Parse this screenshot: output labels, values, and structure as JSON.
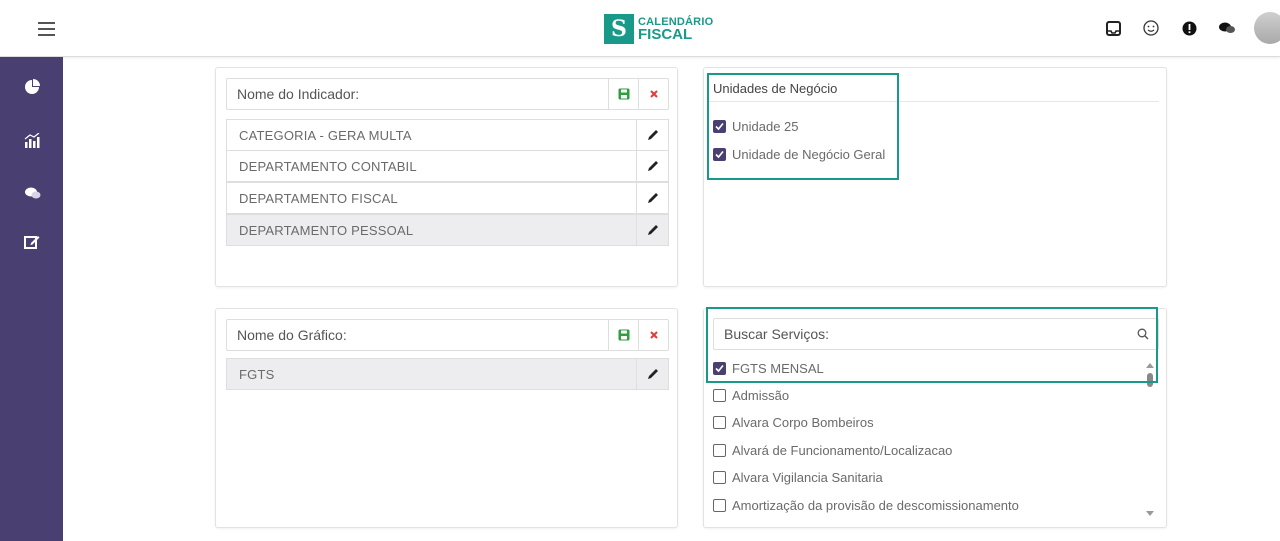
{
  "header": {
    "logo_line1": "CALENDÁRIO",
    "logo_line2": "FISCAL",
    "icons": [
      "menu-icon",
      "inbox-icon",
      "smiley-icon",
      "alert-icon",
      "chat-icon"
    ]
  },
  "sidebar": {
    "icons": [
      "pie-chart-icon",
      "bar-chart-icon",
      "chat-bubbles-icon",
      "edit-icon"
    ]
  },
  "indicador": {
    "input_label": "Nome do Indicador:",
    "items": [
      {
        "label": "CATEGORIA - GERA MULTA"
      },
      {
        "label": "DEPARTAMENTO CONTABIL"
      },
      {
        "label": "DEPARTAMENTO FISCAL"
      },
      {
        "label": "DEPARTAMENTO PESSOAL",
        "selected": true
      }
    ]
  },
  "unidades": {
    "title": "Unidades de Negócio",
    "options": [
      {
        "label": "Unidade 25",
        "checked": true
      },
      {
        "label": "Unidade de Negócio Geral",
        "checked": true
      }
    ]
  },
  "grafico": {
    "input_label": "Nome do Gráfico:",
    "items": [
      {
        "label": "FGTS",
        "selected": true
      }
    ]
  },
  "servicos": {
    "search_placeholder": "Buscar Serviços:",
    "options": [
      {
        "label": "FGTS MENSAL",
        "checked": true
      },
      {
        "label": "Admissão",
        "checked": false
      },
      {
        "label": "Alvara Corpo Bombeiros",
        "checked": false
      },
      {
        "label": "Alvará de Funcionamento/Localizacao",
        "checked": false
      },
      {
        "label": "Alvara Vigilancia Sanitaria",
        "checked": false
      },
      {
        "label": "Amortização da provisão de descomissionamento",
        "checked": false
      }
    ]
  },
  "colors": {
    "accent": "#19998a",
    "sidebar": "#4a3f71",
    "save_icon": "#2e9e3e",
    "delete_icon": "#e23b3b"
  }
}
